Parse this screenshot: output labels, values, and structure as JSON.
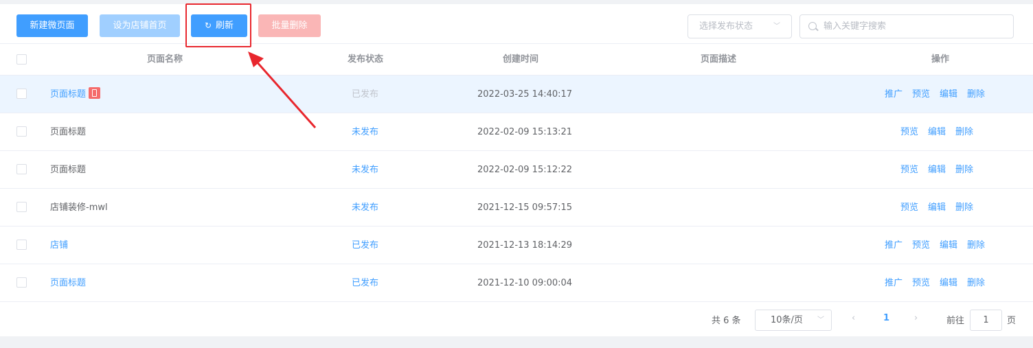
{
  "toolbar": {
    "new_page": "新建微页面",
    "set_home": "设为店铺首页",
    "refresh": "刷新",
    "batch_delete": "批量删除",
    "status_select_placeholder": "选择发布状态",
    "search_placeholder": "输入关键字搜索"
  },
  "table": {
    "headers": [
      "页面名称",
      "发布状态",
      "创建时间",
      "页面描述",
      "操作"
    ],
    "rows": [
      {
        "name": "页面标题",
        "status": "已发布",
        "created": "2022-03-25 14:40:17",
        "ops": [
          "推广",
          "预览",
          "编辑",
          "删除"
        ]
      },
      {
        "name": "页面标题",
        "status": "未发布",
        "created": "2022-02-09 15:13:21",
        "ops": [
          "预览",
          "编辑",
          "删除"
        ]
      },
      {
        "name": "页面标题",
        "status": "未发布",
        "created": "2022-02-09 15:12:22",
        "ops": [
          "预览",
          "编辑",
          "删除"
        ]
      },
      {
        "name": "店铺装修-mwl",
        "status": "未发布",
        "created": "2021-12-15 09:57:15",
        "ops": [
          "预览",
          "编辑",
          "删除"
        ]
      },
      {
        "name": "店铺",
        "status": "已发布",
        "created": "2021-12-13 18:14:29",
        "ops": [
          "推广",
          "预览",
          "编辑",
          "删除"
        ]
      },
      {
        "name": "页面标题",
        "status": "已发布",
        "created": "2021-12-10 09:00:04",
        "ops": [
          "推广",
          "预览",
          "编辑",
          "删除"
        ]
      }
    ]
  },
  "pagination": {
    "total": "共 6 条",
    "page_size": "10条/页",
    "current_page": "1",
    "goto_prefix": "前往",
    "goto_value": "1",
    "goto_suffix": "页"
  },
  "colors": {
    "primary": "#409eff",
    "danger_light": "#fab6b6",
    "annotation": "#e8262d"
  }
}
